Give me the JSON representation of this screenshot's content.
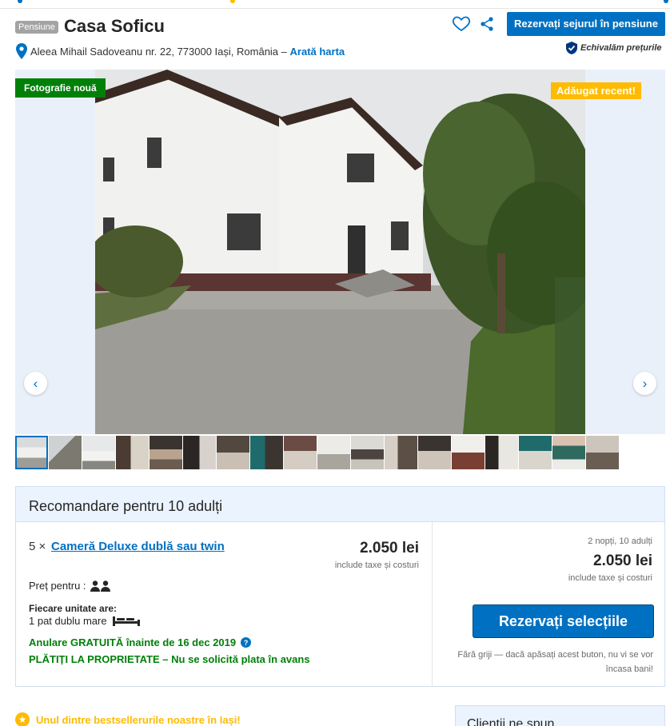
{
  "header": {
    "type_badge": "Pensiune",
    "title": "Casa Soficu",
    "reserve_button": "Rezervați sejurul în pensiune",
    "address": "Aleea Mihail Sadoveanu nr. 22, 773000 Iași, România",
    "address_separator": " – ",
    "map_link": "Arată harta",
    "price_match": "Echivalăm prețurile"
  },
  "gallery": {
    "new_photo_tag": "Fotografie nouă",
    "recent_tag": "Adăugat recent!",
    "prev_arrow": "‹",
    "next_arrow": "›",
    "thumbnail_count": 18,
    "active_thumbnail": 1
  },
  "recommendation": {
    "heading": "Recomandare pentru 10 adulți",
    "room_quantity": "5 ×",
    "room_name": "Cameră Deluxe dublă sau twin",
    "room_price": "2.050 lei",
    "room_tax_note": "include taxe și costuri",
    "price_for_label": "Preț pentru :",
    "unit_has_label": "Fiecare unitate are:",
    "bed_text": "1 pat dublu mare",
    "cancellation": "Anulare GRATUITĂ înainte de 16 dec 2019",
    "pay_at_property": "PLĂTIȚI LA PROPRIETATE – Nu se solicită plata în avans",
    "stay_summary": "2 nopți, 10 adulți",
    "total_price": "2.050 lei",
    "total_tax_note": "include taxe și costuri",
    "select_button": "Rezervați selecțiile",
    "no_charge_note": "Fără griji — dacă apăsați acest buton, nu vi se vor încasa bani!"
  },
  "footer": {
    "bestseller": "Unul dintre bestsellerurile noastre în Iași!",
    "side_box_title": "Clienții ne spun..."
  },
  "colors": {
    "primary": "#0071c2",
    "green": "#008009",
    "yellow": "#febb02",
    "light_blue": "#ebf3ff"
  }
}
